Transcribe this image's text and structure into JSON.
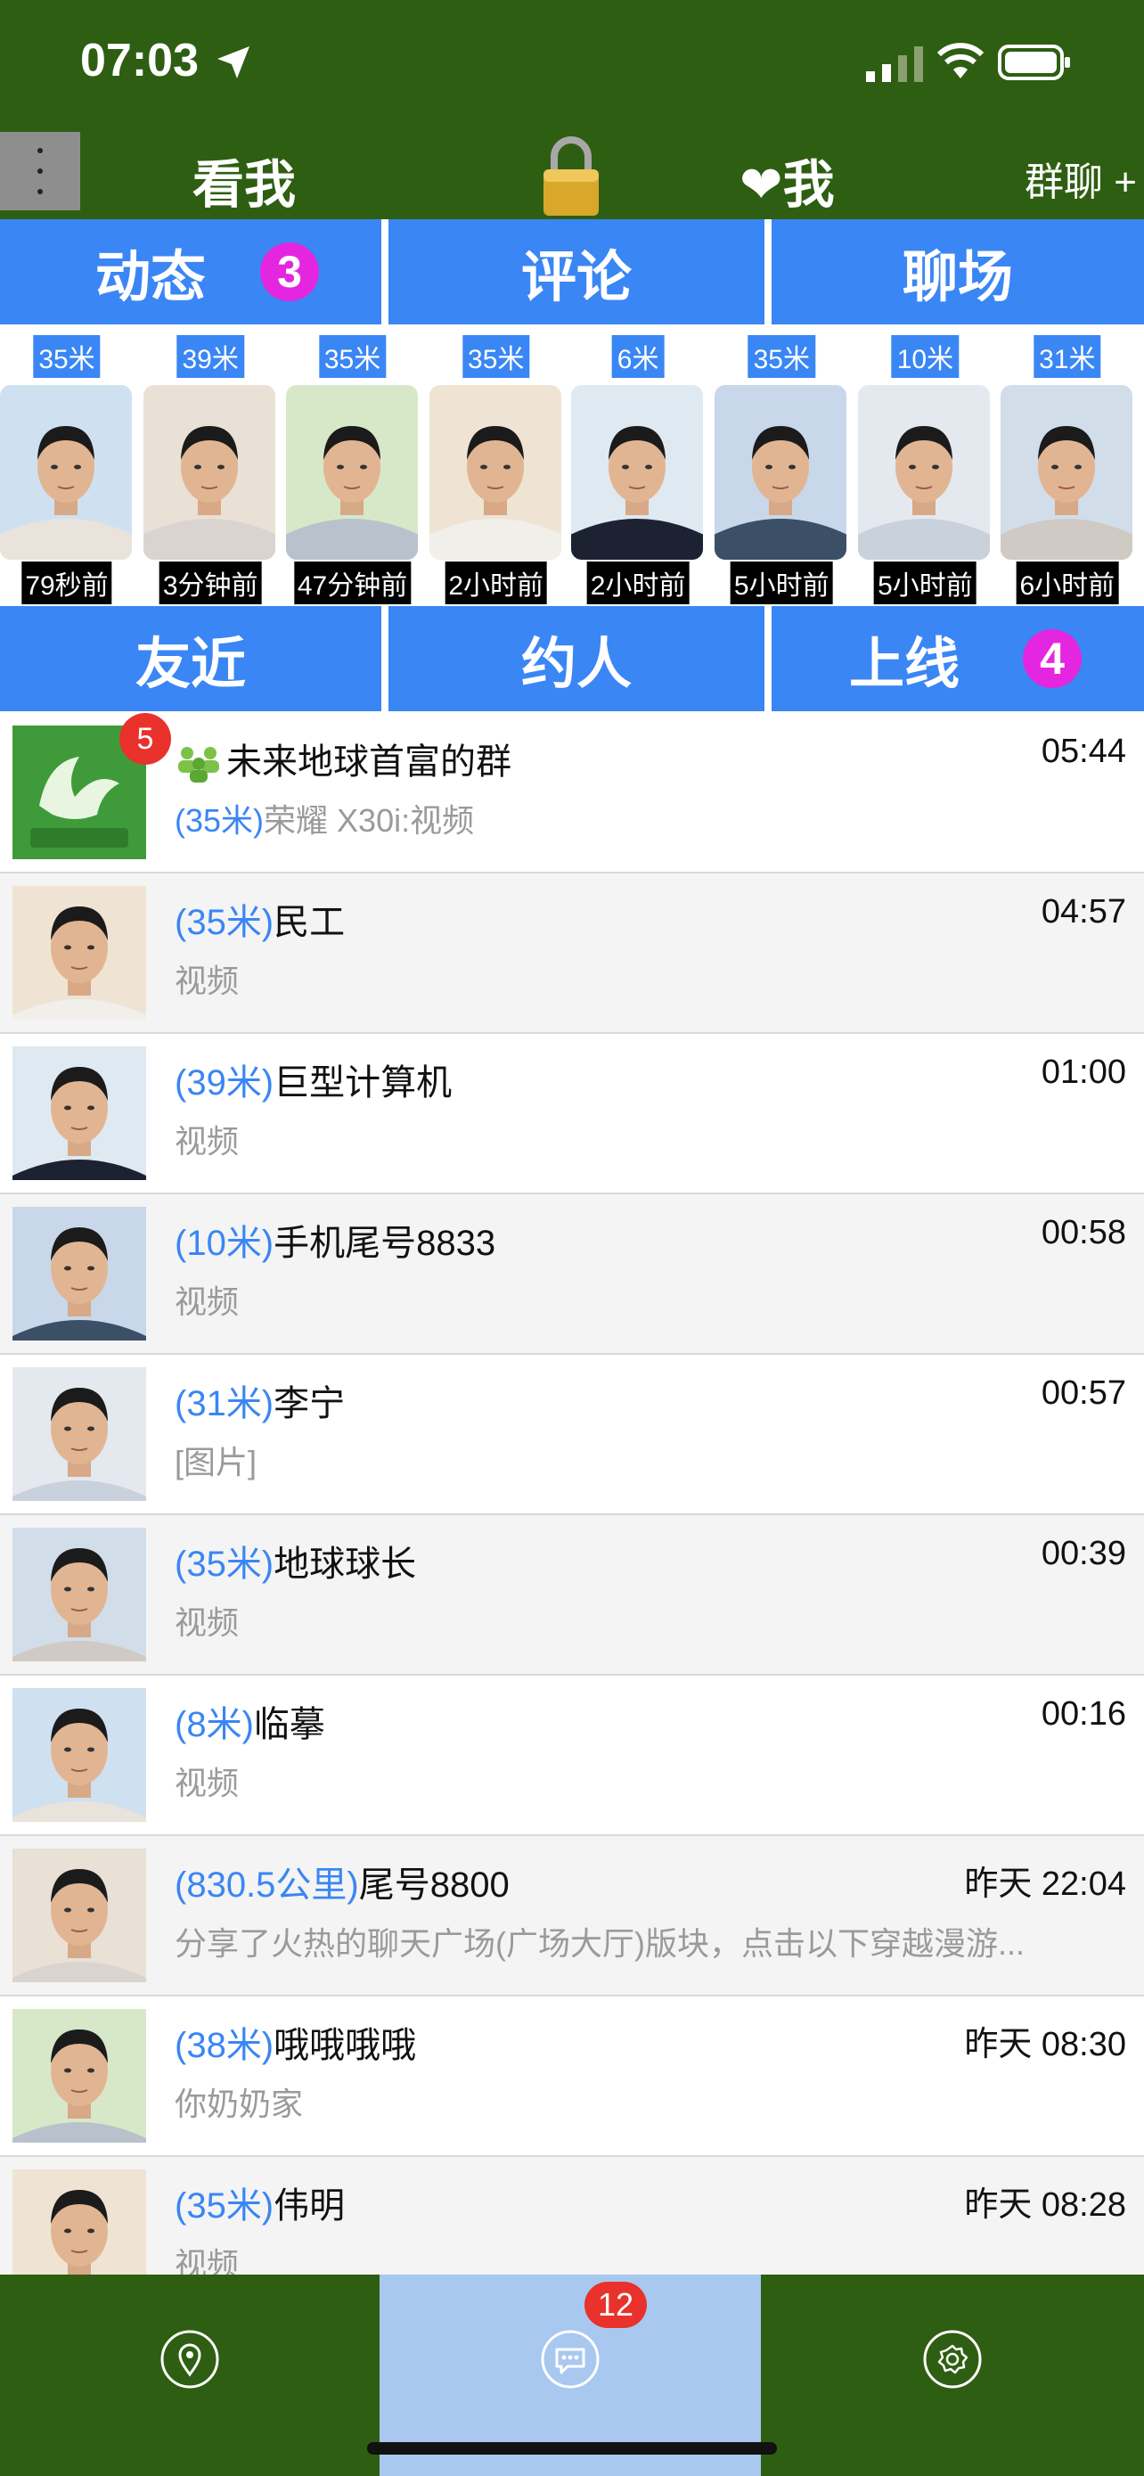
{
  "status": {
    "time": "07:03"
  },
  "header": {
    "left_label": "看我",
    "right_label": "❤我",
    "group_label": "群聊 +"
  },
  "tabs_top": [
    {
      "label": "动态",
      "badge": "3"
    },
    {
      "label": "评论"
    },
    {
      "label": "聊场"
    }
  ],
  "tabs_bottom": [
    {
      "label": "友近"
    },
    {
      "label": "约人"
    },
    {
      "label": "上线",
      "badge": "4"
    }
  ],
  "nearby": [
    {
      "distance": "35米",
      "time": "79秒前"
    },
    {
      "distance": "39米",
      "time": "3分钟前"
    },
    {
      "distance": "35米",
      "time": "47分钟前"
    },
    {
      "distance": "35米",
      "time": "2小时前"
    },
    {
      "distance": "6米",
      "time": "2小时前"
    },
    {
      "distance": "35米",
      "time": "5小时前"
    },
    {
      "distance": "10米",
      "time": "5小时前"
    },
    {
      "distance": "31米",
      "time": "6小时前"
    }
  ],
  "chats": [
    {
      "badge": "5",
      "distance": "",
      "name": "未来地球首富的群",
      "subtitle": "(35米)荣耀 X30i:视频",
      "time": "05:44"
    },
    {
      "distance": "(35米)",
      "name": "民工",
      "subtitle": "视频",
      "time": "04:57"
    },
    {
      "distance": "(39米)",
      "name": "巨型计算机",
      "subtitle": "视频",
      "time": "01:00"
    },
    {
      "distance": "(10米)",
      "name": "手机尾号8833",
      "subtitle": "视频",
      "time": "00:58"
    },
    {
      "distance": "(31米)",
      "name": "李宁",
      "subtitle": "[图片]",
      "time": "00:57"
    },
    {
      "distance": "(35米)",
      "name": "地球球长",
      "subtitle": "视频",
      "time": "00:39"
    },
    {
      "distance": "(8米)",
      "name": "临摹",
      "subtitle": "视频",
      "time": "00:16"
    },
    {
      "distance": "(830.5公里)",
      "name": "尾号8800",
      "subtitle": "分享了火热的聊天广场(广场大厅)版块，点击以下穿越漫游...",
      "time": "昨天 22:04"
    },
    {
      "distance": "(38米)",
      "name": "哦哦哦哦",
      "subtitle": "你奶奶家",
      "time": "昨天 08:30"
    },
    {
      "distance": "(35米)",
      "name": "伟明",
      "subtitle": "视频",
      "time": "昨天 08:28"
    }
  ],
  "tabbar": {
    "messages_badge": "12"
  },
  "colors": {
    "header_green": "#2e5e12",
    "tab_blue": "#3a86f4",
    "badge_magenta": "#e526e0",
    "badge_red": "#e8322b"
  }
}
